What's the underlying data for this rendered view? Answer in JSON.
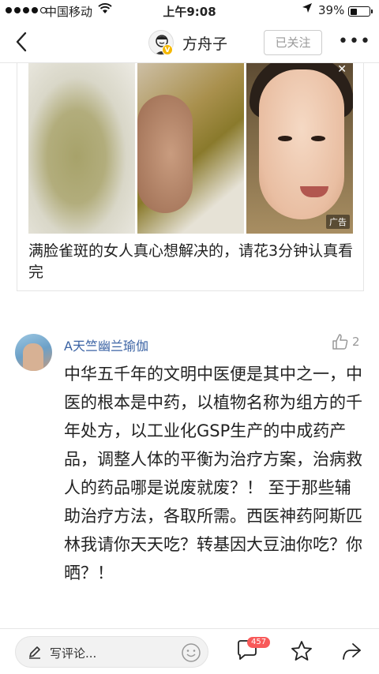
{
  "status_bar": {
    "carrier": "中国移动",
    "time": "上午9:08",
    "battery": "39%"
  },
  "nav": {
    "title": "方舟子",
    "follow_label": "已关注",
    "more_label": "•••"
  },
  "ad": {
    "tag": "广告",
    "title": "满脸雀斑的女人真心想解决的，请花3分钟认真看完"
  },
  "comment": {
    "username": "A天竺幽兰瑜伽",
    "likes": "2",
    "text": "中华五千年的文明中医便是其中之一，中医的根本是中药，以植物名称为组方的千年处方，以工业化GSP生产的中成药产品，调整人体的平衡为治疗方案，治病救人的药品哪是说废就废？！ 至于那些辅助治疗方法，各取所需。西医神药阿斯匹林我请你天天吃？转基因大豆油你吃？你晒？！"
  },
  "bottom_bar": {
    "reply_placeholder": "写评论...",
    "comment_count": "457"
  },
  "icons": {
    "back": "chevron-left-icon",
    "verified": "verified-badge-icon",
    "like": "thumbs-up-icon",
    "pen": "pen-icon",
    "emoji": "emoji-icon",
    "comment": "comment-bubble-icon",
    "favorite": "star-icon",
    "share": "share-arrow-icon"
  },
  "colors": {
    "username": "#3b63a4",
    "badge": "#f85959",
    "verified": "#f5b800"
  }
}
